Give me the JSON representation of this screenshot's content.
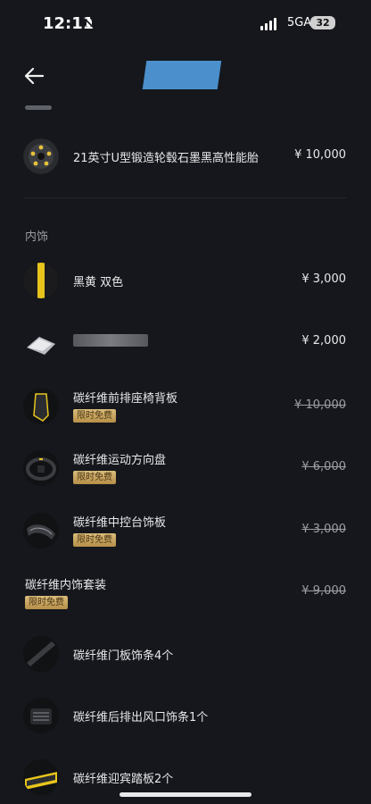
{
  "status": {
    "time": "12:11",
    "network": "5GA",
    "battery": "32"
  },
  "header": {
    "title": ""
  },
  "section": {
    "interior_label": "内饰"
  },
  "items": [
    {
      "name": "21英寸U型锻造轮毂石墨黑高性能胎",
      "price": "¥ 10,000",
      "strike": false,
      "badge": ""
    },
    {
      "name": "黑黄 双色",
      "price": "¥ 3,000",
      "strike": false,
      "badge": ""
    },
    {
      "name": "",
      "price": "¥ 2,000",
      "strike": false,
      "badge": ""
    },
    {
      "name": "碳纤维前排座椅背板",
      "price": "¥ 10,000",
      "strike": true,
      "badge": "限时免费"
    },
    {
      "name": "碳纤维运动方向盘",
      "price": "¥ 6,000",
      "strike": true,
      "badge": "限时免费"
    },
    {
      "name": "碳纤维中控台饰板",
      "price": "¥ 3,000",
      "strike": true,
      "badge": "限时免费"
    },
    {
      "name": "碳纤维内饰套装",
      "price": "¥ 9,000",
      "strike": true,
      "badge": "限时免费"
    },
    {
      "name": "碳纤维门板饰条4个",
      "price": "",
      "strike": false,
      "badge": ""
    },
    {
      "name": "碳纤维后排出风口饰条1个",
      "price": "",
      "strike": false,
      "badge": ""
    },
    {
      "name": "碳纤维迎宾踏板2个",
      "price": "",
      "strike": false,
      "badge": ""
    }
  ]
}
